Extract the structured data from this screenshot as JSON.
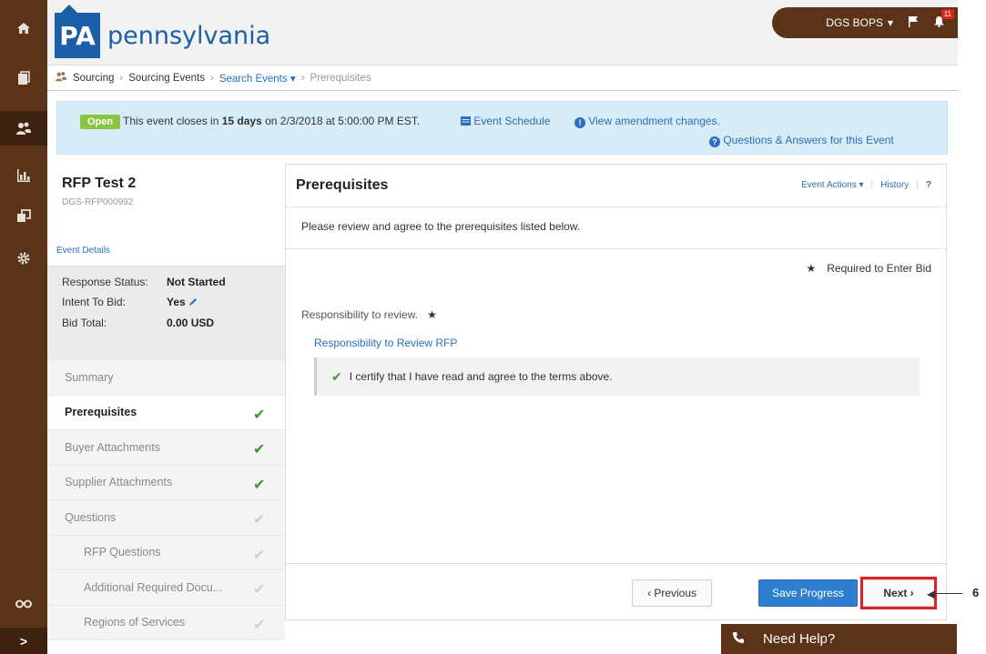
{
  "app": {
    "logo_mark": "PA",
    "logo_text": "pennsylvania"
  },
  "rail": {
    "items": [
      {
        "icon": "home-icon"
      },
      {
        "icon": "documents-icon"
      },
      {
        "icon": "sourcing-users-icon"
      },
      {
        "icon": "analytics-icon"
      },
      {
        "icon": "contracts-icon"
      },
      {
        "icon": "settings-gear-icon"
      },
      {
        "icon": "binoculars-icon"
      }
    ],
    "expand_label": ">"
  },
  "header": {
    "user_label": "DGS BOPS",
    "notification_count": "11"
  },
  "breadcrumb": {
    "items": [
      "Sourcing",
      "Sourcing Events",
      "Search Events",
      "Prerequisites"
    ]
  },
  "banner": {
    "status_pill": "Open",
    "closes_prefix": "This event closes in ",
    "closes_days": "15 days",
    "closes_suffix": " on 2/3/2018 at 5:00:00 PM EST.",
    "schedule_link": "Event Schedule",
    "amendment_link": "View amendment changes.",
    "qa_link": "Questions & Answers for this Event"
  },
  "event": {
    "title": "RFP Test 2",
    "id": "DGS-RFP000992",
    "details_link": "Event Details",
    "response_status_label": "Response Status:",
    "response_status_value": "Not Started",
    "intent_label": "Intent To Bid:",
    "intent_value": "Yes",
    "bid_total_label": "Bid Total:",
    "bid_total_value": "0.00 USD"
  },
  "nav": {
    "items": [
      {
        "label": "Summary",
        "status": "none",
        "sub": false,
        "active": false
      },
      {
        "label": "Prerequisites",
        "status": "done",
        "sub": false,
        "active": true
      },
      {
        "label": "Buyer Attachments",
        "status": "done",
        "sub": false,
        "active": false
      },
      {
        "label": "Supplier Attachments",
        "status": "done",
        "sub": false,
        "active": false
      },
      {
        "label": "Questions",
        "status": "pending",
        "sub": false,
        "active": false
      },
      {
        "label": "RFP Questions",
        "status": "pending",
        "sub": true,
        "active": false
      },
      {
        "label": "Additional Required Docu...",
        "status": "pending",
        "sub": true,
        "active": false
      },
      {
        "label": "Regions of Services",
        "status": "pending",
        "sub": true,
        "active": false
      }
    ]
  },
  "main": {
    "title": "Prerequisites",
    "event_actions": "Event Actions",
    "history": "History",
    "help": "?",
    "intro": "Please review and agree to the prerequisites listed below.",
    "required_legend": "Required to Enter Bid",
    "responsibility_label": "Responsibility to review.",
    "responsibility_link": "Responsibility to Review RFP",
    "certify_text": "I certify that I have read and agree to the terms above.",
    "prev_button": "‹ Previous",
    "save_button": "Save Progress",
    "next_button": "Next ›"
  },
  "callout": {
    "number": "6"
  },
  "help": {
    "label": "Need Help?"
  },
  "colors": {
    "brand_brown": "#5a3319",
    "brand_blue": "#1a5fa8",
    "link_blue": "#2a6ebd",
    "open_green": "#8ac541",
    "check_green": "#3a9b2b",
    "highlight_red": "#e31e24"
  }
}
